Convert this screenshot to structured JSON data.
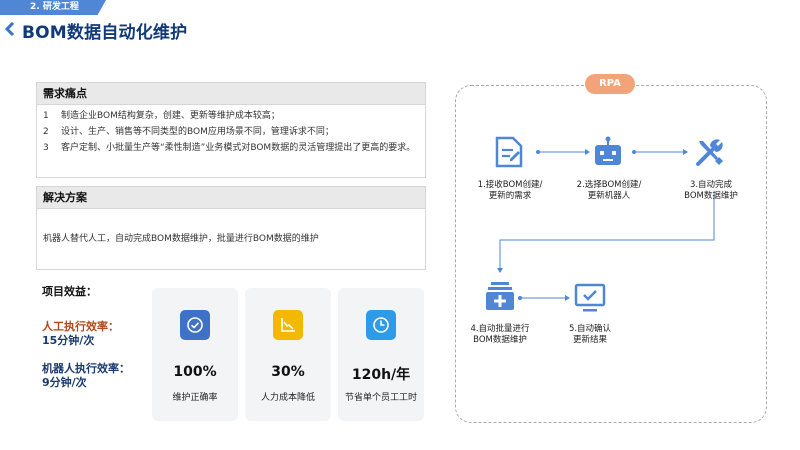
{
  "header": {
    "section_tab": "2. 研发工程",
    "title": "BOM数据自动化维护"
  },
  "requirements": {
    "title": "需求痛点",
    "items": [
      {
        "num": "1",
        "text": "制造企业BOM结构复杂，创建、更新等维护成本较高；"
      },
      {
        "num": "2",
        "text": "设计、生产、销售等不同类型的BOM应用场景不同，管理诉求不同；"
      },
      {
        "num": "3",
        "text": "客户定制、小批量生产等“柔性制造”业务模式对BOM数据的灵活管理提出了更高的要求。"
      }
    ]
  },
  "solution": {
    "title": "解决方案",
    "text": "机器人替代人工，自动完成BOM数据维护，批量进行BOM数据的维护"
  },
  "benefits": {
    "title": "项目效益：",
    "manual_label": "人工执行效率：",
    "manual_value": "15分钟/次",
    "robot_label": "机器人执行效率：",
    "robot_value": "9分钟/次",
    "cards": [
      {
        "icon": "check-circle-icon",
        "color": "#3e72c7",
        "value": "100%",
        "label": "维护正确率"
      },
      {
        "icon": "chart-down-icon",
        "color": "#f5b800",
        "value": "30%",
        "label": "人力成本降低"
      },
      {
        "icon": "clock-icon",
        "color": "#2f9be8",
        "value": "120h/年",
        "label": "节省单个员工工时"
      }
    ]
  },
  "rpa": {
    "badge": "RPA",
    "steps": [
      {
        "icon": "document-edit-icon",
        "line1": "1.接收BOM创建/",
        "line2": "更新的需求"
      },
      {
        "icon": "robot-icon",
        "line1": "2.选择BOM创建/",
        "line2": "更新机器人"
      },
      {
        "icon": "tools-icon",
        "line1": "3.自动完成",
        "line2": "BOM数据维护"
      },
      {
        "icon": "batch-add-icon",
        "line1": "4.自动批量进行",
        "line2": "BOM数据维护"
      },
      {
        "icon": "monitor-check-icon",
        "line1": "5.自动确认",
        "line2": "更新结果"
      }
    ],
    "accent": "#4f87d6"
  }
}
